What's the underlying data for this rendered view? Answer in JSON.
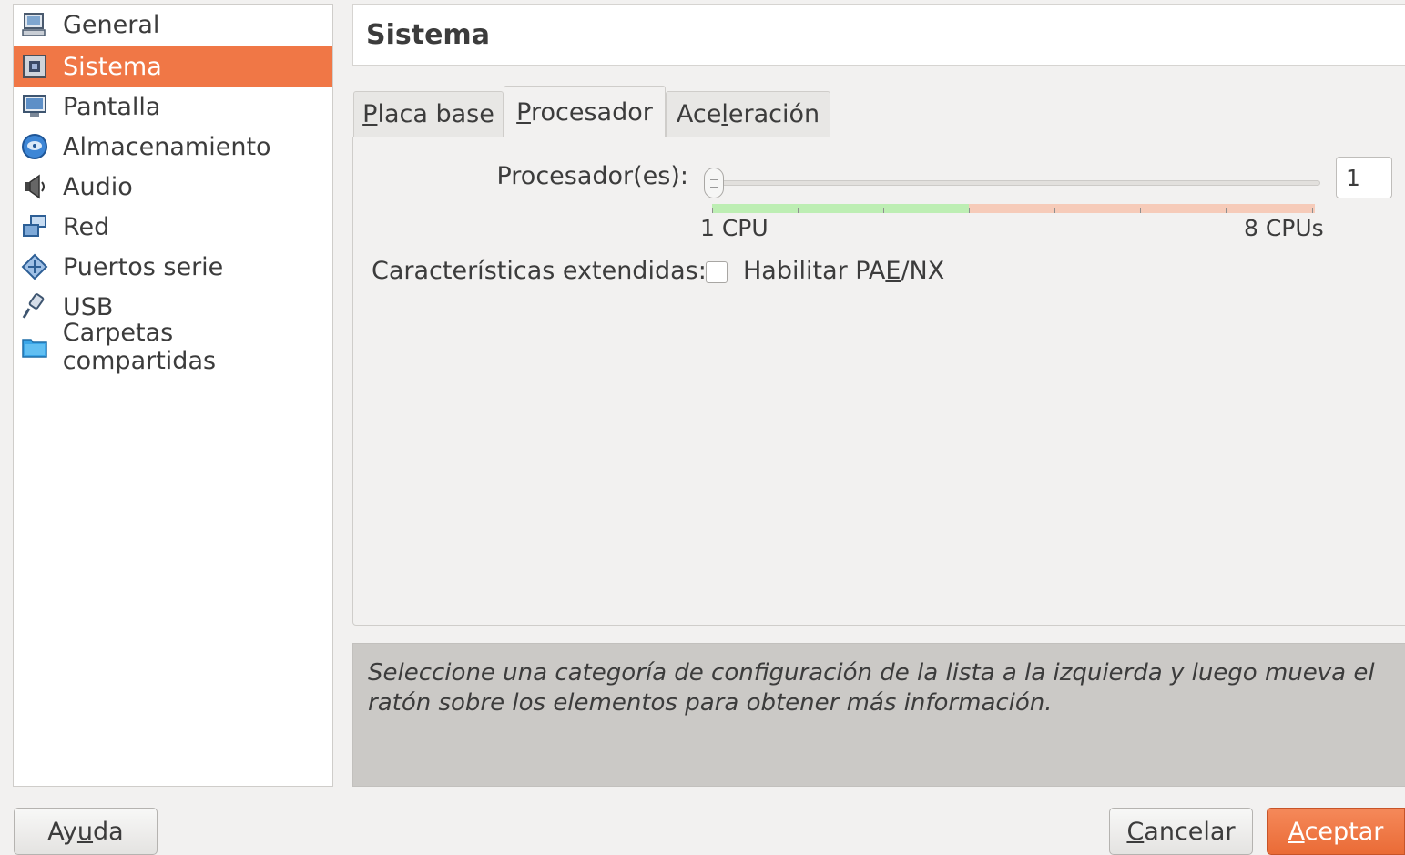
{
  "sidebar": {
    "items": [
      {
        "label": "General",
        "icon": "computer-icon"
      },
      {
        "label": "Sistema",
        "icon": "chip-icon",
        "selected": true
      },
      {
        "label": "Pantalla",
        "icon": "monitor-icon"
      },
      {
        "label": "Almacenamiento",
        "icon": "disk-icon"
      },
      {
        "label": "Audio",
        "icon": "speaker-icon"
      },
      {
        "label": "Red",
        "icon": "network-icon"
      },
      {
        "label": "Puertos serie",
        "icon": "serial-port-icon"
      },
      {
        "label": "USB",
        "icon": "usb-icon"
      },
      {
        "label": "Carpetas compartidas",
        "icon": "folder-icon"
      }
    ]
  },
  "header": {
    "title": "Sistema"
  },
  "tabs": [
    {
      "pre": "",
      "u": "P",
      "post": "laca base"
    },
    {
      "pre": "",
      "u": "P",
      "post": "rocesador",
      "active": true
    },
    {
      "pre": "Ace",
      "u": "l",
      "post": "eración"
    }
  ],
  "processor": {
    "label": "Procesador(es):",
    "value": "1",
    "min_label": "1 CPU",
    "max_label": "8 CPUs",
    "min": 1,
    "max": 8,
    "recommended_max": 4,
    "slider_value": 1
  },
  "extended": {
    "label": "Características extendidas:",
    "checkbox_pre": "Habilitar PA",
    "checkbox_u": "E",
    "checkbox_post": "/NX",
    "checked": false
  },
  "info": {
    "text": "Seleccione una categoría de configuración de la lista a la izquierda y luego mueva el ratón sobre los elementos para obtener más información."
  },
  "buttons": {
    "help": {
      "pre": "Ay",
      "u": "u",
      "post": "da"
    },
    "cancel": {
      "pre": "",
      "u": "C",
      "post": "ancelar"
    },
    "accept": {
      "pre": "",
      "u": "A",
      "post": "ceptar"
    }
  },
  "colors": {
    "selection": "#f07746",
    "recommended_range": "#bdeeb3",
    "over_range": "#f6cbb9"
  }
}
